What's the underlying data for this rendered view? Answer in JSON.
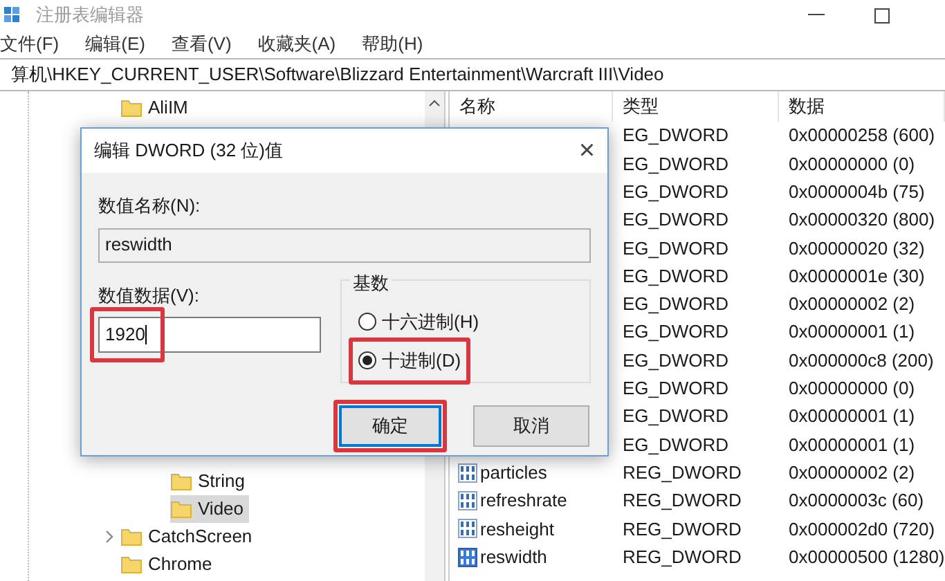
{
  "window": {
    "title": "注册表编辑器"
  },
  "menu": [
    "文件(F)",
    "编辑(E)",
    "查看(V)",
    "收藏夹(A)",
    "帮助(H)"
  ],
  "address": "算机\\HKEY_CURRENT_USER\\Software\\Blizzard Entertainment\\Warcraft III\\Video",
  "tree": [
    {
      "label": "AliIM",
      "selected": false
    },
    {
      "children": [
        {
          "label": "String",
          "selected": false
        },
        {
          "label": "Video",
          "selected": true
        }
      ]
    },
    {
      "label": "CatchScreen",
      "selected": false,
      "expandable": true
    },
    {
      "label": "Chrome",
      "selected": false
    }
  ],
  "list": {
    "columns": [
      "名称",
      "类型",
      "数据"
    ],
    "rows": [
      {
        "type": "EG_DWORD",
        "data": "0x00000258 (600)"
      },
      {
        "type": "EG_DWORD",
        "data": "0x00000000 (0)"
      },
      {
        "type": "EG_DWORD",
        "data": "0x0000004b (75)"
      },
      {
        "type": "EG_DWORD",
        "data": "0x00000320 (800)"
      },
      {
        "type": "EG_DWORD",
        "data": "0x00000020 (32)"
      },
      {
        "type": "EG_DWORD",
        "data": "0x0000001e (30)"
      },
      {
        "type": "EG_DWORD",
        "data": "0x00000002 (2)"
      },
      {
        "type": "EG_DWORD",
        "data": "0x00000001 (1)"
      },
      {
        "type": "EG_DWORD",
        "data": "0x000000c8 (200)"
      },
      {
        "type": "EG_DWORD",
        "data": "0x00000000 (0)"
      },
      {
        "type": "EG_DWORD",
        "data": "0x00000001 (1)"
      },
      {
        "type": "EG_DWORD",
        "data": "0x00000001 (1)"
      },
      {
        "name": "particles",
        "type": "REG_DWORD",
        "data": "0x00000002 (2)",
        "selected": false
      },
      {
        "name": "refreshrate",
        "type": "REG_DWORD",
        "data": "0x0000003c (60)",
        "selected": false
      },
      {
        "name": "resheight",
        "type": "REG_DWORD",
        "data": "0x000002d0 (720)",
        "selected": false
      },
      {
        "name": "reswidth",
        "type": "REG_DWORD",
        "data": "0x00000500 (1280)",
        "selected": true
      }
    ]
  },
  "dialog": {
    "title": "编辑 DWORD (32 位)值",
    "close": "×",
    "name_label": "数值名称(N):",
    "name_value": "reswidth",
    "data_label": "数值数据(V):",
    "data_value": "1920",
    "data_highlighted": true,
    "base": {
      "title": "基数",
      "options": [
        {
          "label": "十六进制(H)",
          "selected": false,
          "highlighted": false
        },
        {
          "label": "十进制(D)",
          "selected": true,
          "highlighted": true
        }
      ]
    },
    "buttons": [
      {
        "label": "确定",
        "default": true,
        "highlighted": true
      },
      {
        "label": "取消",
        "default": false,
        "highlighted": false
      }
    ]
  }
}
